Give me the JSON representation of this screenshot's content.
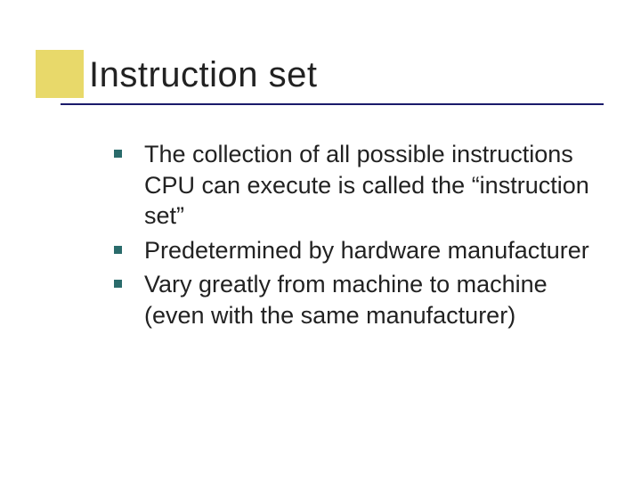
{
  "title": "Instruction set",
  "bullets": [
    "The collection of all possible instructions CPU can execute is called the “instruction set”",
    "Predetermined by hardware manufacturer",
    "Vary greatly from machine to machine (even with the same manufacturer)"
  ],
  "colors": {
    "accent_block": "#e8d96a",
    "rule": "#1a1a6a",
    "bullet_marker": "#2a6b6b",
    "text": "#222222",
    "background": "#ffffff"
  }
}
